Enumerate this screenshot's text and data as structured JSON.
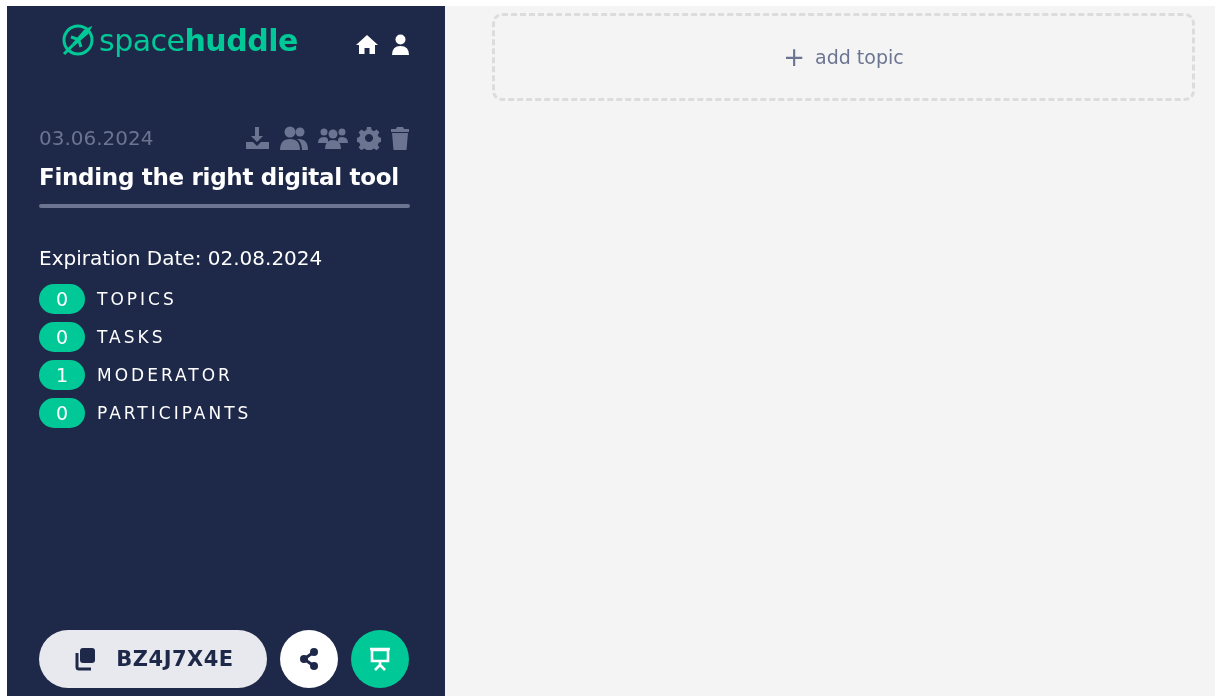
{
  "logo": {
    "text": "space**huddle**"
  },
  "session": {
    "date": "03.06.2024",
    "title": "Finding the right digital tool",
    "expiration": "Expiration Date: 02.08.2024"
  },
  "stats": [
    {
      "count": "0",
      "label": "TOPICS"
    },
    {
      "count": "0",
      "label": "TASKS"
    },
    {
      "count": "1",
      "label": "MODERATOR"
    },
    {
      "count": "0",
      "label": "PARTICIPANTS"
    }
  ],
  "session_code": "BZ4J7X4E",
  "main": {
    "add_topic": "add topic",
    "add_icon": "+"
  }
}
